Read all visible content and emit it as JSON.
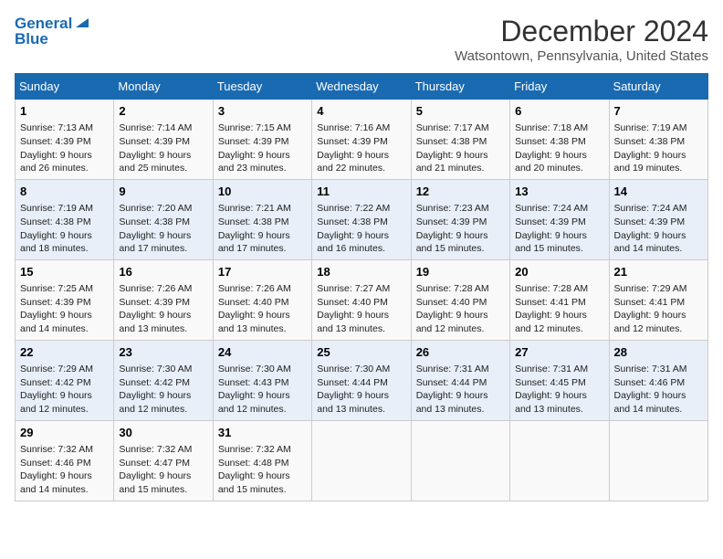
{
  "header": {
    "logo_line1": "General",
    "logo_line2": "Blue",
    "month_year": "December 2024",
    "location": "Watsontown, Pennsylvania, United States"
  },
  "days_of_week": [
    "Sunday",
    "Monday",
    "Tuesday",
    "Wednesday",
    "Thursday",
    "Friday",
    "Saturday"
  ],
  "weeks": [
    [
      {
        "day": "1",
        "info": "Sunrise: 7:13 AM\nSunset: 4:39 PM\nDaylight: 9 hours\nand 26 minutes."
      },
      {
        "day": "2",
        "info": "Sunrise: 7:14 AM\nSunset: 4:39 PM\nDaylight: 9 hours\nand 25 minutes."
      },
      {
        "day": "3",
        "info": "Sunrise: 7:15 AM\nSunset: 4:39 PM\nDaylight: 9 hours\nand 23 minutes."
      },
      {
        "day": "4",
        "info": "Sunrise: 7:16 AM\nSunset: 4:39 PM\nDaylight: 9 hours\nand 22 minutes."
      },
      {
        "day": "5",
        "info": "Sunrise: 7:17 AM\nSunset: 4:38 PM\nDaylight: 9 hours\nand 21 minutes."
      },
      {
        "day": "6",
        "info": "Sunrise: 7:18 AM\nSunset: 4:38 PM\nDaylight: 9 hours\nand 20 minutes."
      },
      {
        "day": "7",
        "info": "Sunrise: 7:19 AM\nSunset: 4:38 PM\nDaylight: 9 hours\nand 19 minutes."
      }
    ],
    [
      {
        "day": "8",
        "info": "Sunrise: 7:19 AM\nSunset: 4:38 PM\nDaylight: 9 hours\nand 18 minutes."
      },
      {
        "day": "9",
        "info": "Sunrise: 7:20 AM\nSunset: 4:38 PM\nDaylight: 9 hours\nand 17 minutes."
      },
      {
        "day": "10",
        "info": "Sunrise: 7:21 AM\nSunset: 4:38 PM\nDaylight: 9 hours\nand 17 minutes."
      },
      {
        "day": "11",
        "info": "Sunrise: 7:22 AM\nSunset: 4:38 PM\nDaylight: 9 hours\nand 16 minutes."
      },
      {
        "day": "12",
        "info": "Sunrise: 7:23 AM\nSunset: 4:39 PM\nDaylight: 9 hours\nand 15 minutes."
      },
      {
        "day": "13",
        "info": "Sunrise: 7:24 AM\nSunset: 4:39 PM\nDaylight: 9 hours\nand 15 minutes."
      },
      {
        "day": "14",
        "info": "Sunrise: 7:24 AM\nSunset: 4:39 PM\nDaylight: 9 hours\nand 14 minutes."
      }
    ],
    [
      {
        "day": "15",
        "info": "Sunrise: 7:25 AM\nSunset: 4:39 PM\nDaylight: 9 hours\nand 14 minutes."
      },
      {
        "day": "16",
        "info": "Sunrise: 7:26 AM\nSunset: 4:39 PM\nDaylight: 9 hours\nand 13 minutes."
      },
      {
        "day": "17",
        "info": "Sunrise: 7:26 AM\nSunset: 4:40 PM\nDaylight: 9 hours\nand 13 minutes."
      },
      {
        "day": "18",
        "info": "Sunrise: 7:27 AM\nSunset: 4:40 PM\nDaylight: 9 hours\nand 13 minutes."
      },
      {
        "day": "19",
        "info": "Sunrise: 7:28 AM\nSunset: 4:40 PM\nDaylight: 9 hours\nand 12 minutes."
      },
      {
        "day": "20",
        "info": "Sunrise: 7:28 AM\nSunset: 4:41 PM\nDaylight: 9 hours\nand 12 minutes."
      },
      {
        "day": "21",
        "info": "Sunrise: 7:29 AM\nSunset: 4:41 PM\nDaylight: 9 hours\nand 12 minutes."
      }
    ],
    [
      {
        "day": "22",
        "info": "Sunrise: 7:29 AM\nSunset: 4:42 PM\nDaylight: 9 hours\nand 12 minutes."
      },
      {
        "day": "23",
        "info": "Sunrise: 7:30 AM\nSunset: 4:42 PM\nDaylight: 9 hours\nand 12 minutes."
      },
      {
        "day": "24",
        "info": "Sunrise: 7:30 AM\nSunset: 4:43 PM\nDaylight: 9 hours\nand 12 minutes."
      },
      {
        "day": "25",
        "info": "Sunrise: 7:30 AM\nSunset: 4:44 PM\nDaylight: 9 hours\nand 13 minutes."
      },
      {
        "day": "26",
        "info": "Sunrise: 7:31 AM\nSunset: 4:44 PM\nDaylight: 9 hours\nand 13 minutes."
      },
      {
        "day": "27",
        "info": "Sunrise: 7:31 AM\nSunset: 4:45 PM\nDaylight: 9 hours\nand 13 minutes."
      },
      {
        "day": "28",
        "info": "Sunrise: 7:31 AM\nSunset: 4:46 PM\nDaylight: 9 hours\nand 14 minutes."
      }
    ],
    [
      {
        "day": "29",
        "info": "Sunrise: 7:32 AM\nSunset: 4:46 PM\nDaylight: 9 hours\nand 14 minutes."
      },
      {
        "day": "30",
        "info": "Sunrise: 7:32 AM\nSunset: 4:47 PM\nDaylight: 9 hours\nand 15 minutes."
      },
      {
        "day": "31",
        "info": "Sunrise: 7:32 AM\nSunset: 4:48 PM\nDaylight: 9 hours\nand 15 minutes."
      },
      {
        "day": "",
        "info": ""
      },
      {
        "day": "",
        "info": ""
      },
      {
        "day": "",
        "info": ""
      },
      {
        "day": "",
        "info": ""
      }
    ]
  ]
}
